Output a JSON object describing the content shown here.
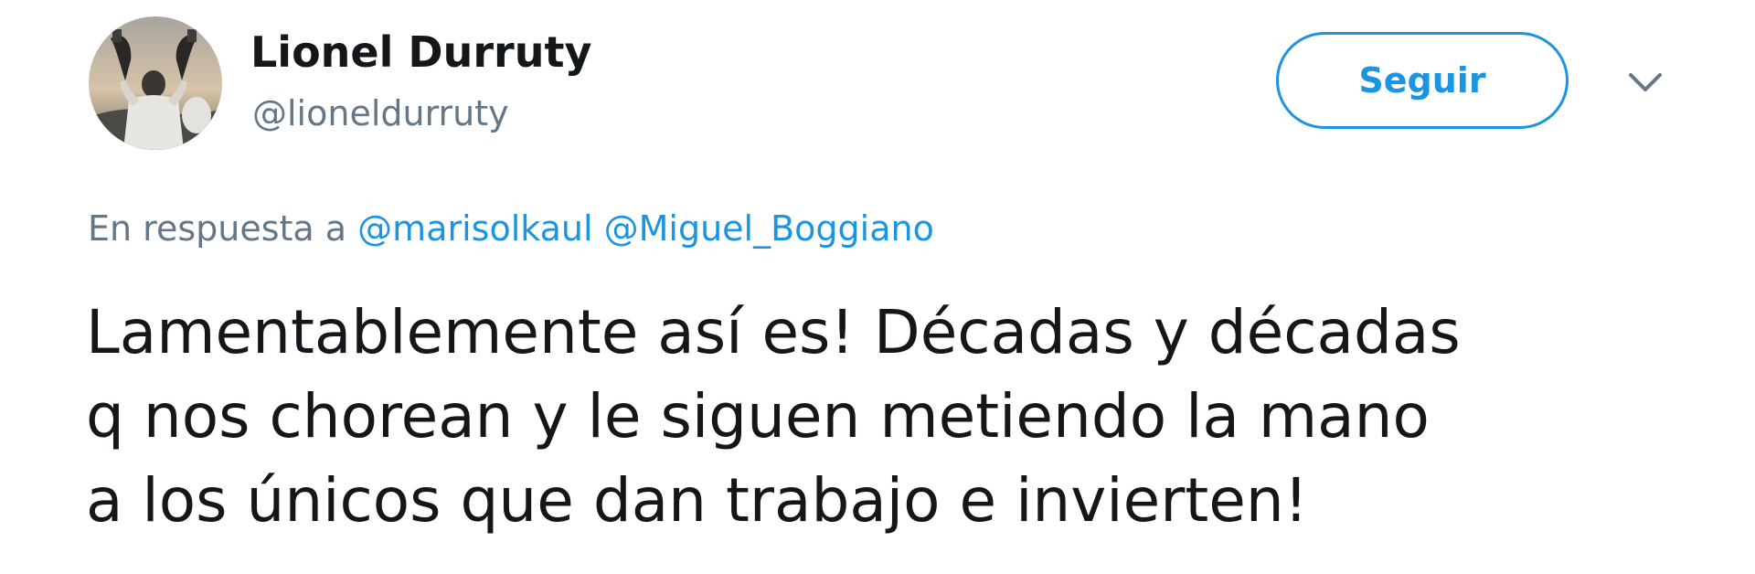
{
  "user": {
    "display_name": "Lionel Durruty",
    "handle": "@lioneldurruty"
  },
  "follow_button": {
    "label": "Seguir"
  },
  "reply": {
    "prefix": "En respuesta a",
    "mentions": [
      "@marisolkaul",
      "@Miguel_Boggiano"
    ]
  },
  "tweet": {
    "lines": [
      "Lamentablemente así es! Décadas y décadas",
      "q nos chorean y le siguen metiendo la mano",
      "a los únicos que dan trabajo e invierten!"
    ]
  },
  "icons": {
    "caret": "chevron-down-icon"
  },
  "colors": {
    "link": "#1b95e0",
    "secondary_text": "#657786",
    "primary_text": "#14171a"
  }
}
